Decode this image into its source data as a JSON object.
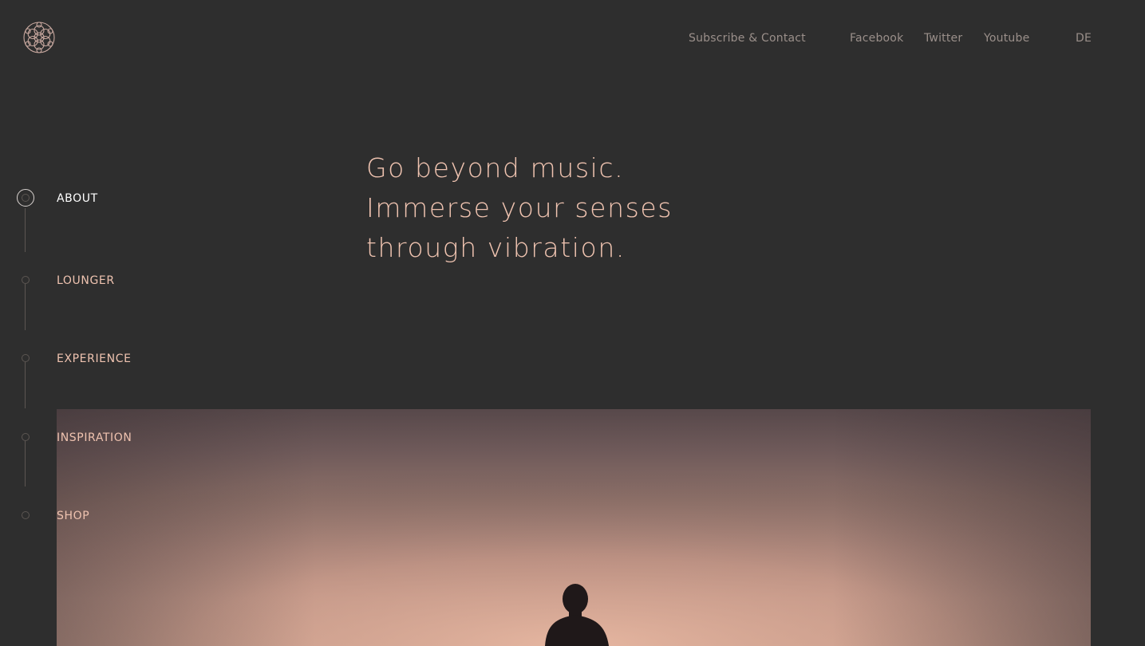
{
  "header": {
    "logo_icon": "flower-of-life-logo-icon",
    "nav": {
      "subscribe": "Subscribe & Contact",
      "facebook": "Facebook",
      "twitter": "Twitter",
      "youtube": "Youtube",
      "language": "DE"
    }
  },
  "hero": {
    "line1": "Go beyond music.",
    "line2": "Immerse your senses",
    "line3": "through vibration."
  },
  "sidenav": {
    "items": [
      {
        "label": "ABOUT",
        "active": true
      },
      {
        "label": "LOUNGER",
        "active": false
      },
      {
        "label": "EXPERIENCE",
        "active": false
      },
      {
        "label": "INSPIRATION",
        "active": false
      },
      {
        "label": "SHOP",
        "active": false
      }
    ]
  },
  "colors": {
    "background": "#2e2e2e",
    "accent": "#efc3b0",
    "nav_text": "#9a8f8a",
    "active": "#ffffff"
  }
}
